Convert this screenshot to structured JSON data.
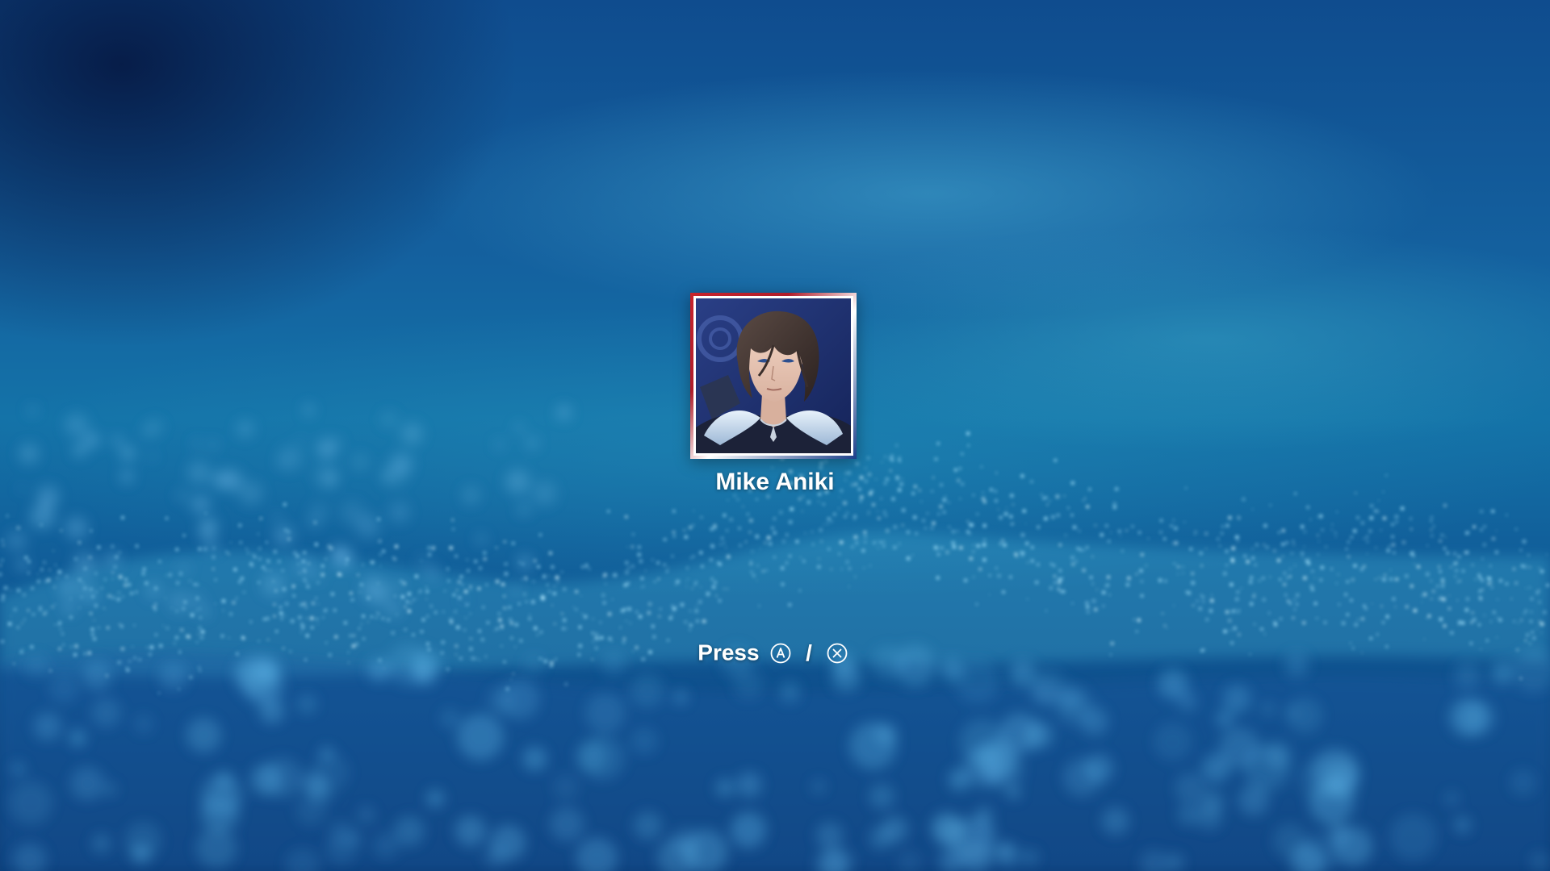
{
  "profile": {
    "username": "Mike Aniki",
    "avatar_icon": "character-portrait-icon"
  },
  "prompt": {
    "text": "Press",
    "button_a_icon": "a-button-icon",
    "separator": "/",
    "button_cross_icon": "cross-button-icon"
  },
  "colors": {
    "frame_red": "#c8242c",
    "frame_blue": "#1b3f8a",
    "text": "#ffffff",
    "background": "#1473a8"
  }
}
